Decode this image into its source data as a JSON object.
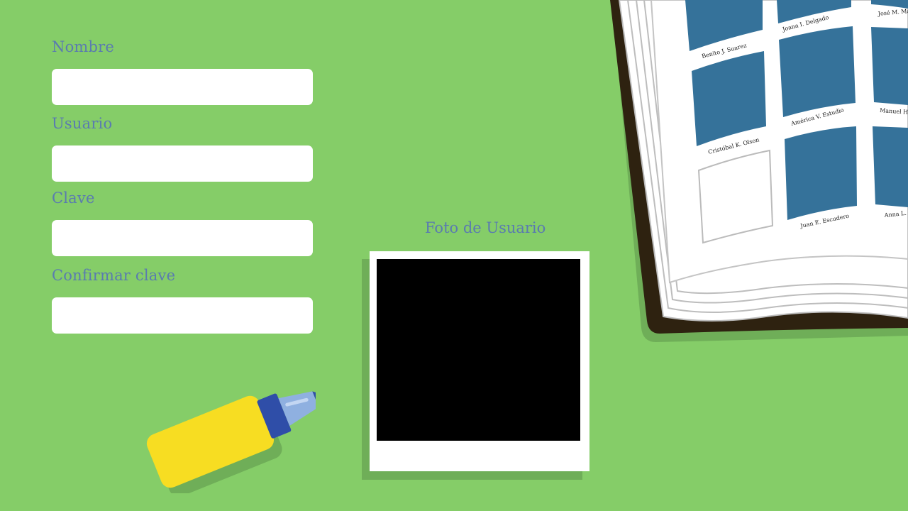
{
  "form": {
    "nombre": {
      "label": "Nombre",
      "value": "",
      "placeholder": ""
    },
    "usuario": {
      "label": "Usuario",
      "value": "",
      "placeholder": ""
    },
    "clave": {
      "label": "Clave",
      "value": "",
      "placeholder": ""
    },
    "confirmar": {
      "label": "Confirmar clave",
      "value": "",
      "placeholder": ""
    }
  },
  "photo": {
    "label": "Foto de Usuario"
  },
  "album": {
    "names": [
      "Benito J. Suarez",
      "Joana I. Delgado",
      "José M. Ma",
      "Cristóbal K. Olson",
      "América V. Estudio",
      "Manuel H. I",
      "Juan E. Escudero",
      "Anna L. A"
    ]
  },
  "colors": {
    "background": "#85cd68",
    "label": "#5a7bb0",
    "glue_body": "#f7dd22",
    "glue_cap": "#2f4ea8",
    "album_cover": "#2e2210",
    "photo_slot": "#35729a"
  }
}
